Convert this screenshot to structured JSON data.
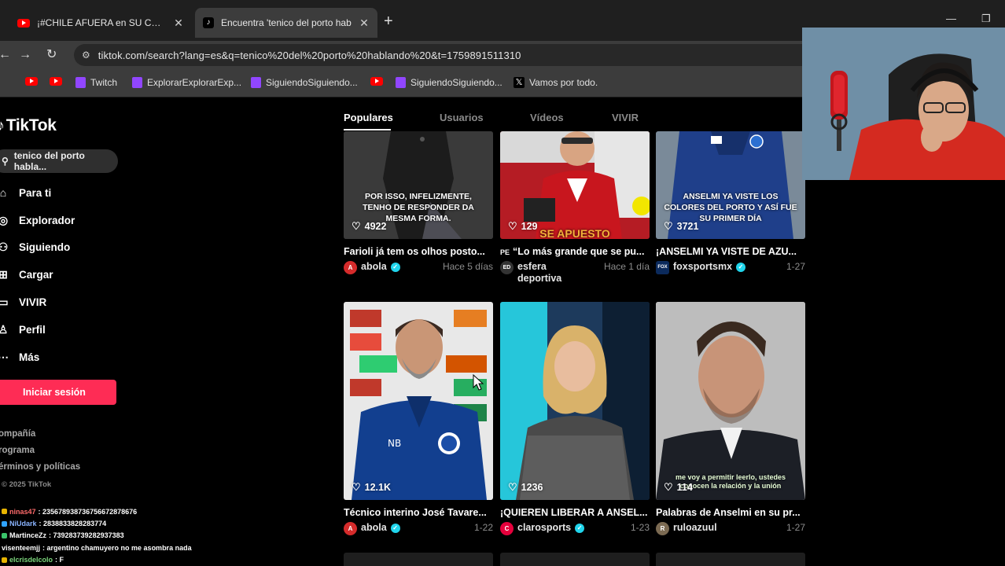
{
  "browser": {
    "tabs": [
      {
        "title": "¡#CHILE AFUERA en SU CASA! #",
        "favicon": "youtube-icon"
      },
      {
        "title": "Encuentra 'tenico del porto hab",
        "favicon": "tiktok-icon"
      }
    ],
    "url": "tiktok.com/search?lang=es&q=tenico%20del%20porto%20hablando%20&t=1759891511310",
    "bookmarks": [
      {
        "label": "",
        "icon": "youtube-icon"
      },
      {
        "label": "",
        "icon": "youtube-icon"
      },
      {
        "label": "Twitch",
        "icon": "twitch-icon"
      },
      {
        "label": "ExplorarExplorarExp...",
        "icon": "twitch-icon"
      },
      {
        "label": "SiguiendoSiguiendo...",
        "icon": "twitch-icon"
      },
      {
        "label": "",
        "icon": "youtube-icon"
      },
      {
        "label": "SiguiendoSiguiendo...",
        "icon": "twitch-icon"
      },
      {
        "label": "Vamos por todo.",
        "icon": "x-icon"
      }
    ]
  },
  "tiktok": {
    "logo": "TikTok",
    "search_value": "tenico del porto habla...",
    "nav": [
      {
        "label": "Para ti",
        "icon": "home-icon"
      },
      {
        "label": "Explorador",
        "icon": "compass-icon"
      },
      {
        "label": "Siguiendo",
        "icon": "following-icon"
      },
      {
        "label": "Cargar",
        "icon": "upload-icon"
      },
      {
        "label": "VIVIR",
        "icon": "live-icon"
      },
      {
        "label": "Perfil",
        "icon": "profile-icon"
      },
      {
        "label": "Más",
        "icon": "more-icon"
      }
    ],
    "login_label": "Iniciar sesión",
    "footer_links": [
      "ompañía",
      "rograma",
      "érminos y políticas"
    ],
    "copyright": "2025 TikTok",
    "filter_tabs": [
      "Populares",
      "Usuarios",
      "Vídeos",
      "VIVIR"
    ],
    "colors": {
      "accent": "#fe2c55",
      "verified": "#20d5ec"
    },
    "videos": [
      {
        "likes": "4922",
        "overlay": "POR ISSO, INFELIZMENTE, TENHO DE RESPONDER DA MESMA FORMA.",
        "title": "Farioli já tem os olhos posto...",
        "author": "abola",
        "verified": true,
        "date": "Hace 5 días",
        "avatar_text": "A"
      },
      {
        "likes": "129",
        "overlay": "SE APUESTO",
        "title": "“Lo más grande que se pu...",
        "title_prefix": "PE",
        "author": "esfera deportiva",
        "verified": false,
        "date": "Hace 1 día",
        "avatar_text": "ED"
      },
      {
        "likes": "3721",
        "overlay": "ANSELMI YA VISTE LOS COLORES DEL PORTO Y ASÍ FUE SU PRIMER DÍA",
        "title": "¡ANSELMI YA VISTE DE AZU...",
        "author": "foxsportsmx",
        "verified": true,
        "date": "1-27",
        "avatar_text": "FOX"
      },
      {
        "likes": "12.1K",
        "overlay": "",
        "title": "Técnico interino José Tavare...",
        "author": "abola",
        "verified": true,
        "date": "1-22",
        "avatar_text": "A"
      },
      {
        "likes": "1236",
        "overlay": "",
        "title": "¡QUIEREN LIBERAR A ANSEL...",
        "author": "clarosports",
        "verified": true,
        "date": "1-23",
        "avatar_text": "C"
      },
      {
        "likes": "114",
        "overlay": "me voy a permitir leerlo, ustedes conocen la relación y la unión",
        "title": "Palabras de Anselmi en su pr...",
        "author": "ruloazuul",
        "verified": false,
        "date": "1-27",
        "avatar_text": "R"
      }
    ]
  },
  "chat": [
    {
      "user": "ninas47",
      "message": ": 235678938736756672878676",
      "color": "#ff6b6b"
    },
    {
      "user": "NiUdark",
      "message": ": 2838833828283774",
      "color": "#8ab4ff"
    },
    {
      "user": "MartinceZz",
      "message": ": 739283739282937383",
      "color": "#ffffff"
    },
    {
      "user": "visenteemjj",
      "message": ": argentino chamuyero no me asombra nada",
      "color": "#ffffff"
    },
    {
      "user": "elcrisdelcolo",
      "message": ": F",
      "color": "#7cd67c"
    }
  ]
}
